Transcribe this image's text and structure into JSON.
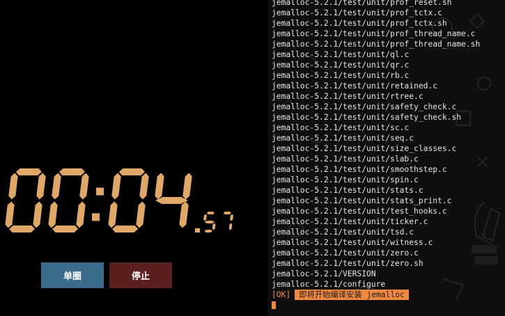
{
  "stopwatch": {
    "main": "00:04",
    "fraction": ".57",
    "lap_label": "单圈",
    "stop_label": "停止",
    "colors": {
      "digits": "#e0a866",
      "lap_button": "#3a6b8a",
      "stop_button": "#5c1f1f"
    }
  },
  "terminal": {
    "lines": [
      "jemalloc-5.2.1/test/unit/prof_reset.sh",
      "jemalloc-5.2.1/test/unit/prof_tctx.c",
      "jemalloc-5.2.1/test/unit/prof_tctx.sh",
      "jemalloc-5.2.1/test/unit/prof_thread_name.c",
      "jemalloc-5.2.1/test/unit/prof_thread_name.sh",
      "jemalloc-5.2.1/test/unit/ql.c",
      "jemalloc-5.2.1/test/unit/qr.c",
      "jemalloc-5.2.1/test/unit/rb.c",
      "jemalloc-5.2.1/test/unit/retained.c",
      "jemalloc-5.2.1/test/unit/rtree.c",
      "jemalloc-5.2.1/test/unit/safety_check.c",
      "jemalloc-5.2.1/test/unit/safety_check.sh",
      "jemalloc-5.2.1/test/unit/sc.c",
      "jemalloc-5.2.1/test/unit/seq.c",
      "jemalloc-5.2.1/test/unit/size_classes.c",
      "jemalloc-5.2.1/test/unit/slab.c",
      "jemalloc-5.2.1/test/unit/smoothstep.c",
      "jemalloc-5.2.1/test/unit/spin.c",
      "jemalloc-5.2.1/test/unit/stats.c",
      "jemalloc-5.2.1/test/unit/stats_print.c",
      "jemalloc-5.2.1/test/unit/test_hooks.c",
      "jemalloc-5.2.1/test/unit/ticker.c",
      "jemalloc-5.2.1/test/unit/tsd.c",
      "jemalloc-5.2.1/test/unit/witness.c",
      "jemalloc-5.2.1/test/unit/zero.c",
      "jemalloc-5.2.1/test/unit/zero.sh",
      "jemalloc-5.2.1/VERSION",
      "jemalloc-5.2.1/configure"
    ],
    "status_tag": "[OK]",
    "status_message": "即将开始编译安装 jemalloc",
    "colors": {
      "text": "#e6e6e6",
      "accent": "#f0883e",
      "background": "#0f0f0f"
    }
  }
}
